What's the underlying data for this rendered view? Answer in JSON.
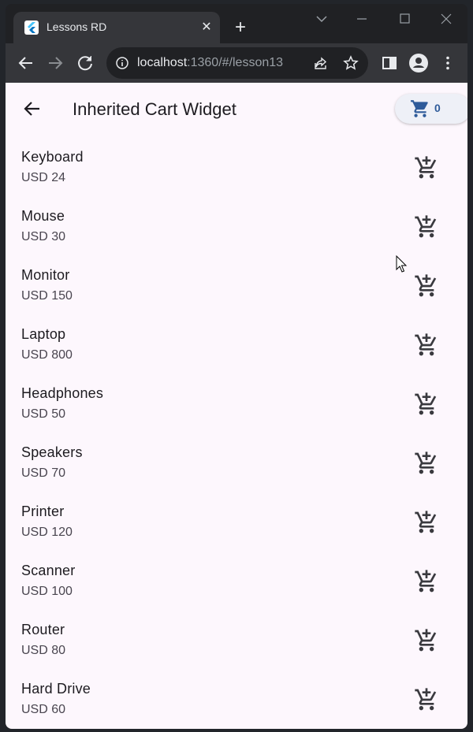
{
  "browser": {
    "tab_title": "Lessons RD",
    "tab_close": "✕",
    "new_tab": "+",
    "url_host": "localhost",
    "url_rest": ":1360/#/lesson13"
  },
  "app": {
    "title": "Inherited Cart Widget",
    "cart_count": "0",
    "accent_color": "#2f5b9a"
  },
  "products": [
    {
      "name": "Keyboard",
      "price": "USD 24"
    },
    {
      "name": "Mouse",
      "price": "USD 30"
    },
    {
      "name": "Monitor",
      "price": "USD 150"
    },
    {
      "name": "Laptop",
      "price": "USD 800"
    },
    {
      "name": "Headphones",
      "price": "USD 50"
    },
    {
      "name": "Speakers",
      "price": "USD 70"
    },
    {
      "name": "Printer",
      "price": "USD 120"
    },
    {
      "name": "Scanner",
      "price": "USD 100"
    },
    {
      "name": "Router",
      "price": "USD 80"
    },
    {
      "name": "Hard Drive",
      "price": "USD 60"
    }
  ]
}
